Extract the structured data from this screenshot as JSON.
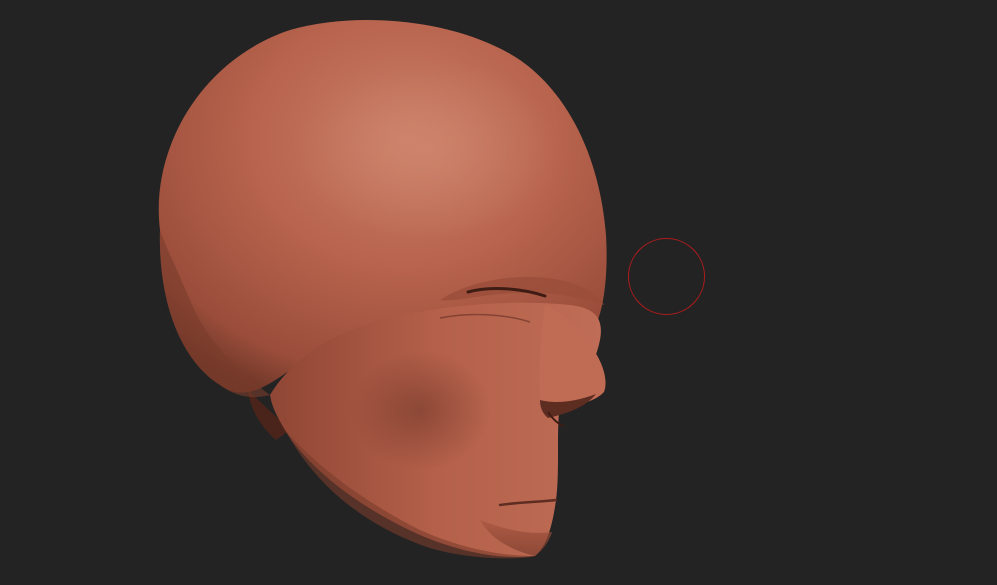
{
  "canvas": {
    "background_color": "#232323"
  },
  "model": {
    "icon": "sculpted-head-mesh",
    "material_color": "#b8644e",
    "highlight_color": "#c97d66",
    "shadow_color": "#6e3628"
  },
  "brush_cursor": {
    "icon": "circle-brush-cursor",
    "color": "#b01c1c"
  }
}
